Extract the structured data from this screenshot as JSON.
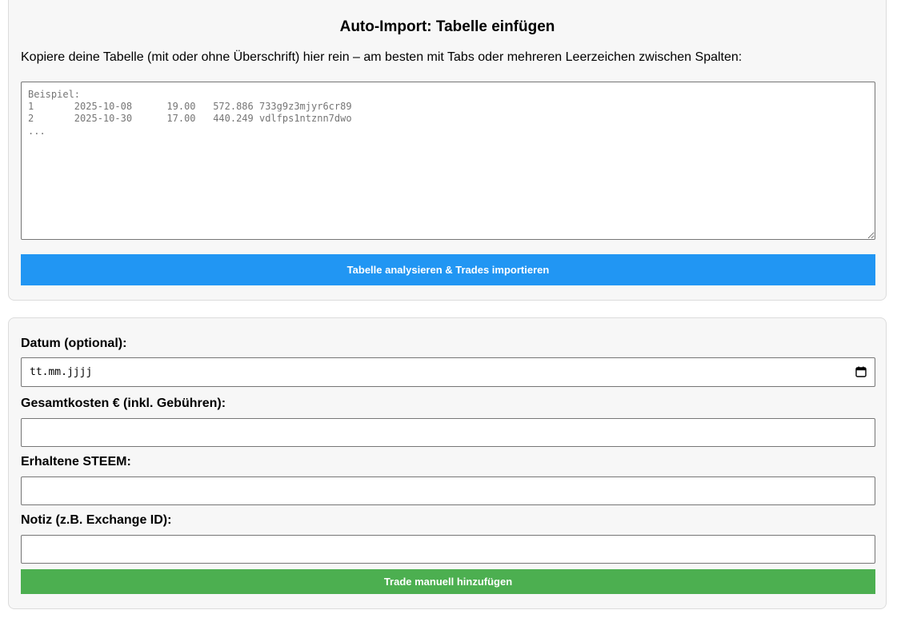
{
  "import": {
    "title": "Auto-Import: Tabelle einfügen",
    "instruction": "Kopiere deine Tabelle (mit oder ohne Überschrift) hier rein – am besten mit Tabs oder mehreren Leerzeichen zwischen Spalten:",
    "textarea_value": "",
    "textarea_placeholder": "Beispiel:\n1       2025-10-08      19.00   572.886 733g9z3mjyr6cr89\n2       2025-10-30      17.00   440.249 vdlfps1ntznn7dwo\n...",
    "analyze_button": "Tabelle analysieren & Trades importieren"
  },
  "manual": {
    "date_label": "Datum (optional):",
    "date_placeholder": "tt.mm.jjjj",
    "cost_label": "Gesamtkosten € (inkl. Gebühren):",
    "cost_value": "",
    "steem_label": "Erhaltene STEEM:",
    "steem_value": "",
    "note_label": "Notiz (z.B. Exchange ID):",
    "note_value": "",
    "add_button": "Trade manuell hinzufügen"
  },
  "colors": {
    "analyze_button": "#2196f3",
    "add_button": "#4caf50",
    "card_background": "#f7f7f7"
  },
  "icons": {
    "date_picker": "calendar-icon"
  }
}
